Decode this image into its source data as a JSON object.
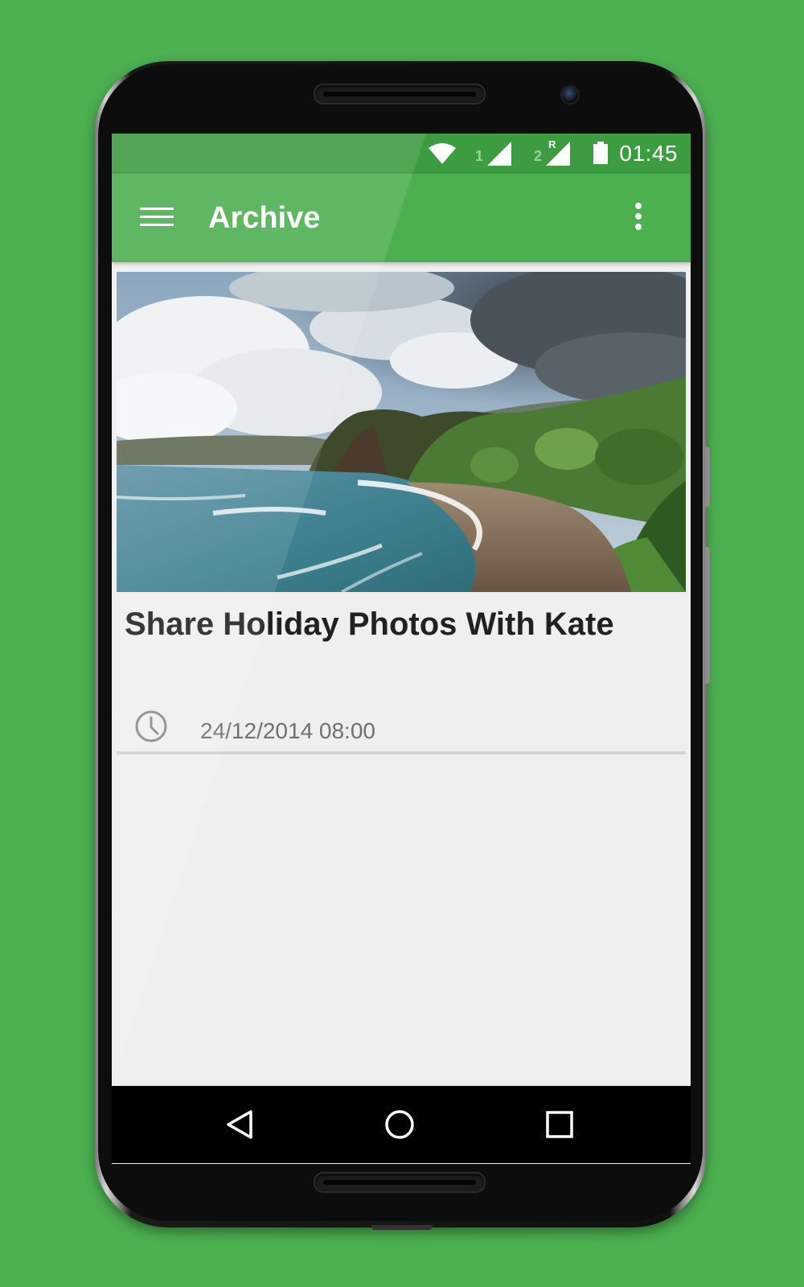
{
  "status_bar": {
    "time": "01:45",
    "sim1_label": "1",
    "sim2_label": "2",
    "roaming_label": "R",
    "icons": [
      "wifi-icon",
      "signal-icon",
      "signal-roaming-icon",
      "battery-icon"
    ]
  },
  "app_bar": {
    "title": "Archive",
    "menu_icon": "hamburger-menu-icon",
    "overflow_icon": "more-vert-icon"
  },
  "cards": [
    {
      "title": "Share Holiday Photos With Kate",
      "date": "24/12/2014 08:00",
      "image": "beach-landscape-photo",
      "date_icon": "clock-icon"
    }
  ],
  "nav_bar": {
    "icons": [
      "back-icon",
      "home-icon",
      "recents-icon"
    ]
  },
  "colors": {
    "background": "#4caf50",
    "app_bar": "#4caf50",
    "status_bar": "#3d9b41",
    "screen_bg": "#efefef",
    "title_text": "#212121",
    "date_text": "#707070"
  }
}
